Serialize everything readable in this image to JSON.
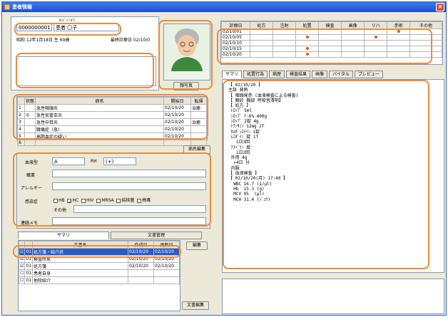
{
  "window": {
    "title": "患者情報",
    "close_glyph": "×"
  },
  "patient": {
    "id": "0000000001",
    "name_kana": "ｶﾝｼﾞｬ ﾊﾅｺ",
    "name": "患者 〇子",
    "birth": "昭和 12年1月18日 生 69歳",
    "insurance_label": "最終診療日 02/10/0"
  },
  "photo": {
    "button_label": "顔写真"
  },
  "problem_list": {
    "headers": [
      "",
      "状態",
      "病名",
      "開始日",
      "転帰"
    ],
    "rows": [
      [
        "1",
        "",
        "急性咽頭炎",
        "02/10/20",
        "治癒"
      ],
      [
        "2",
        "◎",
        "急性気管支炎",
        "02/10/20",
        ""
      ],
      [
        "3",
        "",
        "急性中耳炎",
        "02/10/20",
        "治癒"
      ],
      [
        "4",
        "",
        "腰痛症（急）",
        "02/10/20",
        ""
      ],
      [
        "5",
        "",
        "高脂血症の疑い",
        "02/10/20",
        ""
      ],
      [
        "6",
        "",
        "",
        "",
        ""
      ]
    ],
    "edit_button": "病名編集"
  },
  "profile": {
    "blood_label": "血液型",
    "blood_abo": "A",
    "blood_rh_label": "RH",
    "blood_rh": "(+)",
    "occupation_label": "職業",
    "allergy_label": "アレルギー",
    "infection_label": "感染症",
    "infections": [
      "HB",
      "HC",
      "HIV",
      "MRSA",
      "結核菌",
      "梅毒"
    ],
    "infection_checked": [
      false,
      true,
      false,
      false,
      false,
      false
    ],
    "other_label": "その他",
    "memo_label": "連絡メモ"
  },
  "bottom_tabs": [
    "サマリ",
    "文書管理"
  ],
  "doc_list": {
    "headers": [
      "",
      "",
      "文書名",
      "作成日",
      "更新日"
    ],
    "rows": [
      [
        "☑",
        "01",
        "処方箋・紹介状",
        "02/10/20",
        "02/10/20"
      ],
      [
        "☑",
        "01",
        "検査所見",
        "02/10/20",
        "02/10/20"
      ],
      [
        "☑",
        "01",
        "処方箋",
        "02/10/20",
        "02/10/20"
      ],
      [
        "☐",
        "01",
        "患者自身",
        "",
        ""
      ],
      [
        "☐",
        "01",
        "他院紹介",
        "",
        ""
      ]
    ],
    "edit_button": "編集",
    "manage_button": "文書編集"
  },
  "history": {
    "headers": [
      "診療日",
      "処方",
      "注射",
      "処置",
      "検査",
      "画像",
      "リハ",
      "手術",
      "その他"
    ],
    "rows": [
      [
        "02/10/01",
        "",
        "",
        "",
        "",
        "",
        "",
        "●",
        ""
      ],
      [
        "02/10/05",
        "",
        "",
        "●",
        "",
        "",
        "●",
        "",
        ""
      ],
      [
        "02/10/10",
        "",
        "",
        "",
        "",
        "",
        "",
        "",
        ""
      ],
      [
        "02/10/15",
        "",
        "",
        "●",
        "",
        "",
        "",
        "",
        ""
      ],
      [
        "02/10/20",
        "",
        "",
        "●",
        "",
        "",
        "",
        "",
        ""
      ]
    ]
  },
  "right_tabs": [
    "サマリ",
    "処置行為",
    "病歴",
    "検査結果",
    "画像",
    "バイタル",
    "プレビュー"
  ],
  "summary_text": "【 02/10/20 】\n主訴 発熱\n【 咽頭発赤 (血液検査による検査)\n【 聴診 胸部 呼吸音清明】\n【 処方 】\n ﾄﾛｯﾌﾟ 5ml\n ｼﾛｯﾌﾟ ﾅ-6% 400g\n ｼﾛｯﾌﾟ 2錠 4g\n ﾄﾗﾝｻﾐﾝ 12mg 2T\n ｶﾙﾎﾞｼｽﾃｲﾝ 1錠\n ﾑｺﾀﾞｲﾝ 錠 1T\n   1日3回\n ｱｽﾍﾞﾘﾝ 錠\n   1日2回\n 外用 4g\n  ×4日 分\n 内服\n【 血液検査 】\n【 02/10/20(月) 17:40 】\n  WBC 16.7 (1/μl)\n  Hb  15.3 (g)\n  MCV 95  (μl)\n  MCH 31.4 (ｼﾞｭｳ)"
}
